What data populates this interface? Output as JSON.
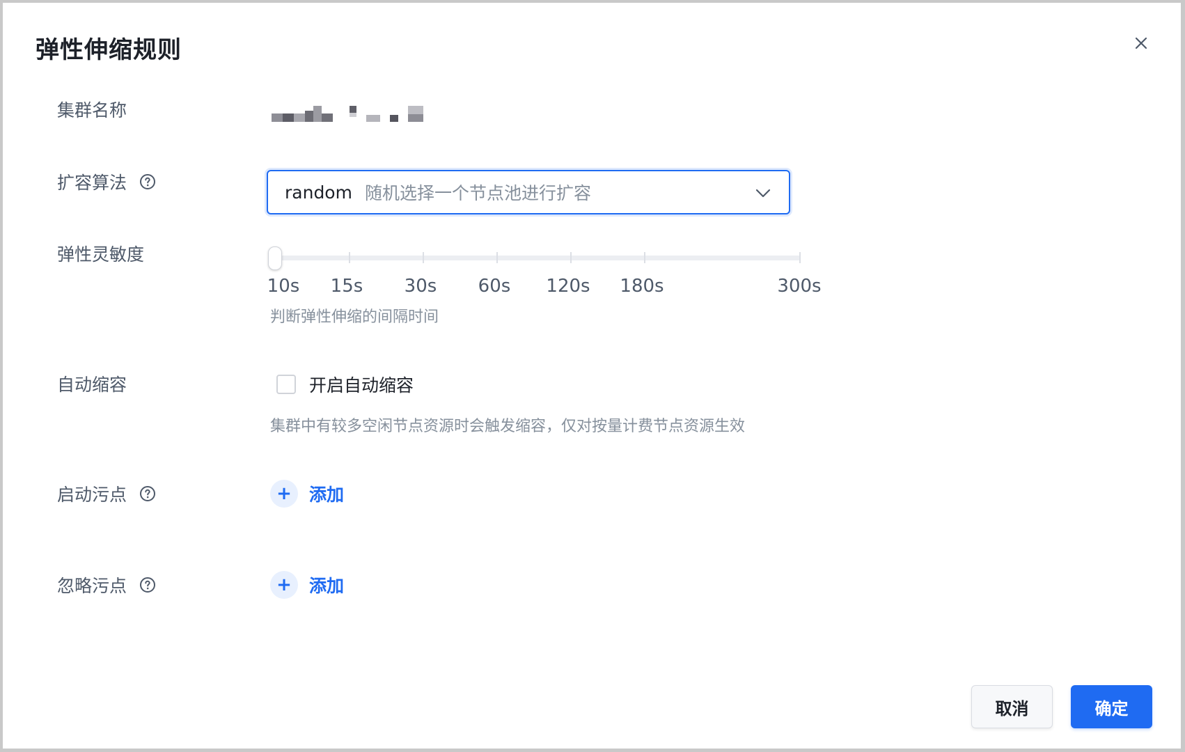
{
  "dialog": {
    "title": "弹性伸缩规则",
    "close_icon": "close-icon"
  },
  "form": {
    "cluster_name": {
      "label": "集群名称",
      "value_masked": true
    },
    "expand_algorithm": {
      "label": "扩容算法",
      "help_icon": "question-circle-icon",
      "selected_value": "random",
      "selected_desc": "随机选择一个节点池进行扩容",
      "chevron_icon": "chevron-down-icon"
    },
    "sensitivity": {
      "label": "弹性灵敏度",
      "ticks": [
        "10s",
        "15s",
        "30s",
        "60s",
        "120s",
        "180s",
        "300s"
      ],
      "selected": "10s",
      "hint": "判断弹性伸缩的间隔时间"
    },
    "auto_scale_down": {
      "label": "自动缩容",
      "checkbox_label": "开启自动缩容",
      "checked": false,
      "hint": "集群中有较多空闲节点资源时会触发缩容，仅对按量计费节点资源生效"
    },
    "startup_taints": {
      "label": "启动污点",
      "help_icon": "question-circle-icon",
      "add_label": "添加"
    },
    "ignore_taints": {
      "label": "忽略污点",
      "help_icon": "question-circle-icon",
      "add_label": "添加"
    }
  },
  "footer": {
    "cancel_label": "取消",
    "ok_label": "确定"
  },
  "colors": {
    "primary": "#1f6bf2",
    "text": "#1d2129",
    "label": "#4e5969",
    "hint": "#86909c"
  }
}
